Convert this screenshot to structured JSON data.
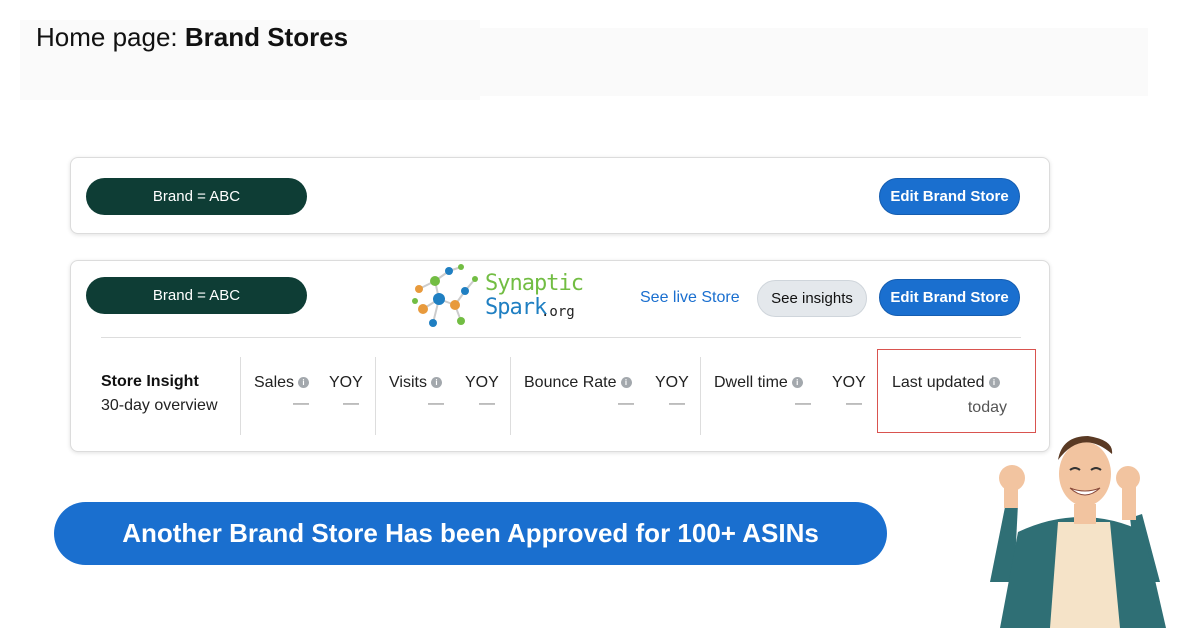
{
  "header": {
    "prefix": "Home page: ",
    "title": "Brand Stores"
  },
  "card1": {
    "brand_label": "Brand = ABC",
    "edit_label": "Edit Brand Store"
  },
  "card2": {
    "brand_label": "Brand = ABC",
    "live_label": "See live Store",
    "insights_label": "See insights",
    "edit_label": "Edit Brand Store",
    "logo": {
      "line1": "Synaptic",
      "line2": "Spark",
      "suffix": ".org"
    },
    "insight": {
      "title": "Store Insight",
      "subtitle": "30-day overview"
    },
    "metrics": [
      {
        "label": "Sales",
        "info": true,
        "value": "—"
      },
      {
        "label": "YOY",
        "info": false,
        "value": "—"
      },
      {
        "label": "Visits",
        "info": true,
        "value": "—"
      },
      {
        "label": "YOY",
        "info": false,
        "value": "—"
      },
      {
        "label": "Bounce Rate",
        "info": true,
        "value": "—"
      },
      {
        "label": "YOY",
        "info": false,
        "value": "—"
      },
      {
        "label": "Dwell time",
        "info": true,
        "value": "—"
      },
      {
        "label": "YOY",
        "info": false,
        "value": "—"
      }
    ],
    "last_updated": {
      "label": "Last updated",
      "value": "today"
    }
  },
  "banner": {
    "text": "Another Brand Store Has been Approved for 100+ ASINs"
  },
  "icons": {
    "info": "info-icon",
    "logo": "molecule-logo-icon",
    "person": "celebrating-person-illustration"
  },
  "colors": {
    "brand_pill": "#0e3d35",
    "primary": "#1a6fcf",
    "secondary_button": "#e4e8ec",
    "highlight_border": "#d9534f"
  }
}
